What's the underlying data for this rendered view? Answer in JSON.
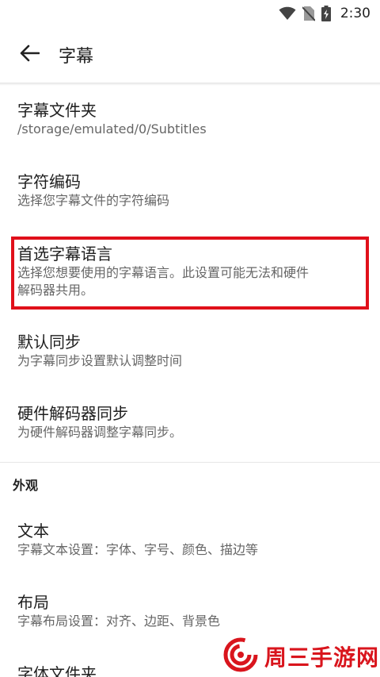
{
  "status_bar": {
    "time": "2:30",
    "icons": [
      "wifi-icon",
      "no-sim-icon",
      "battery-charging-icon"
    ]
  },
  "toolbar": {
    "back_icon": "arrow-left-icon",
    "title": "字幕"
  },
  "settings": [
    {
      "title": "字幕文件夹",
      "summary": "/storage/emulated/0/Subtitles"
    },
    {
      "title": "字符编码",
      "summary": "选择您字幕文件的字符编码"
    },
    {
      "title": "首选字幕语言",
      "summary_lines": [
        "选择您想要使用的字幕语言。此设置可能无法和硬件",
        "解码器共用。"
      ]
    },
    {
      "title": "默认同步",
      "summary": "为字幕同步设置默认调整时间"
    },
    {
      "title": "硬件解码器同步",
      "summary": "为硬件解码器调整字幕同步。"
    }
  ],
  "appearance": {
    "header": "外观",
    "items": [
      {
        "title": "文本",
        "summary": "字幕文本设置：字体、字号、颜色、描边等"
      },
      {
        "title": "布局",
        "summary": "字幕布局设置：对齐、边距、背景色"
      },
      {
        "title": "字体文件夹"
      }
    ]
  },
  "highlight_color": "#e0101a",
  "watermark": {
    "text": "周三手游网",
    "color": "#d9151d"
  }
}
